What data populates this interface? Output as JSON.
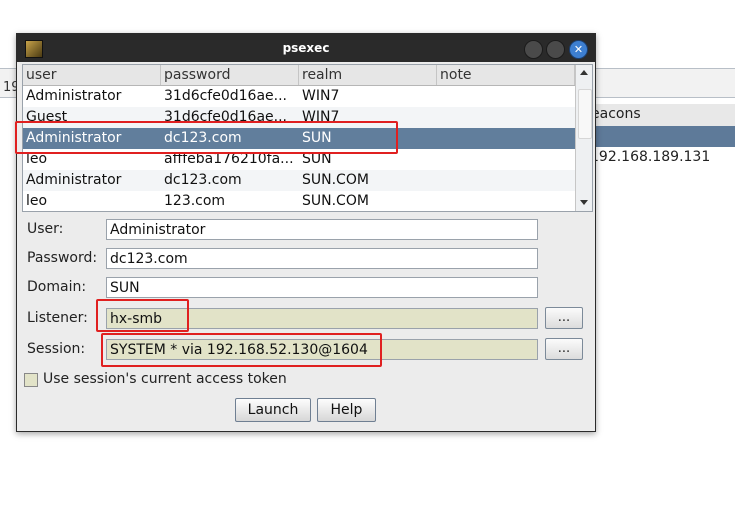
{
  "background": {
    "left_snippet": "19",
    "table_header": "eacons",
    "table_cell": "192.168.189.131"
  },
  "window": {
    "title": "psexec",
    "close_glyph": "✕",
    "icon": "app-icon"
  },
  "table": {
    "columns": [
      "user",
      "password",
      "realm",
      "note"
    ],
    "rows": [
      {
        "user": "Administrator",
        "password": "31d6cfe0d16ae...",
        "realm": "WIN7",
        "note": ""
      },
      {
        "user": "Guest",
        "password": "31d6cfe0d16ae...",
        "realm": "WIN7",
        "note": ""
      },
      {
        "user": "Administrator",
        "password": "dc123.com",
        "realm": "SUN",
        "note": ""
      },
      {
        "user": "leo",
        "password": "afffeba176210fa...",
        "realm": "SUN",
        "note": ""
      },
      {
        "user": "Administrator",
        "password": "dc123.com",
        "realm": "SUN.COM",
        "note": ""
      },
      {
        "user": "leo",
        "password": "123.com",
        "realm": "SUN.COM",
        "note": ""
      }
    ],
    "selected_row": 2
  },
  "form": {
    "user_label": "User:",
    "user_value": "Administrator",
    "password_label": "Password:",
    "password_value": "dc123.com",
    "domain_label": "Domain:",
    "domain_value": "SUN",
    "listener_label": "Listener:",
    "listener_value": "hx-smb",
    "session_label": "Session:",
    "session_value": "SYSTEM * via  192.168.52.130@1604",
    "browse_label": "...",
    "token_label": "Use session's current access token",
    "token_checked": false
  },
  "buttons": {
    "launch": "Launch",
    "help": "Help"
  },
  "colors": {
    "selection": "#617e9c",
    "annotation": "#e02020",
    "close_button": "#3d7fd1"
  }
}
